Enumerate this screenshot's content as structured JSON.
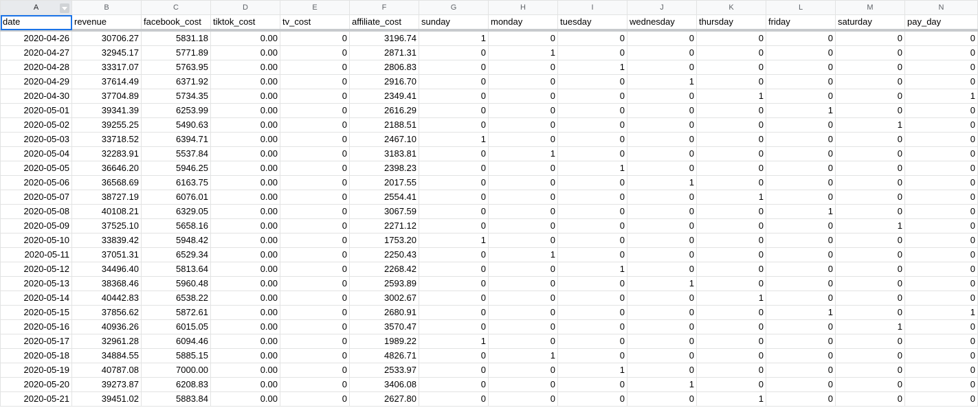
{
  "columns": [
    "A",
    "B",
    "C",
    "D",
    "E",
    "F",
    "G",
    "H",
    "I",
    "J",
    "K",
    "L",
    "M",
    "N"
  ],
  "headers": [
    "date",
    "revenue",
    "facebook_cost",
    "tiktok_cost",
    "tv_cost",
    "affiliate_cost",
    "sunday",
    "monday",
    "tuesday",
    "wednesday",
    "thursday",
    "friday",
    "saturday",
    "pay_day"
  ],
  "rows": [
    [
      "2020-04-26",
      "30706.27",
      "5831.18",
      "0.00",
      "0",
      "3196.74",
      "1",
      "0",
      "0",
      "0",
      "0",
      "0",
      "0",
      "0"
    ],
    [
      "2020-04-27",
      "32945.17",
      "5771.89",
      "0.00",
      "0",
      "2871.31",
      "0",
      "1",
      "0",
      "0",
      "0",
      "0",
      "0",
      "0"
    ],
    [
      "2020-04-28",
      "33317.07",
      "5763.95",
      "0.00",
      "0",
      "2806.83",
      "0",
      "0",
      "1",
      "0",
      "0",
      "0",
      "0",
      "0"
    ],
    [
      "2020-04-29",
      "37614.49",
      "6371.92",
      "0.00",
      "0",
      "2916.70",
      "0",
      "0",
      "0",
      "1",
      "0",
      "0",
      "0",
      "0"
    ],
    [
      "2020-04-30",
      "37704.89",
      "5734.35",
      "0.00",
      "0",
      "2349.41",
      "0",
      "0",
      "0",
      "0",
      "1",
      "0",
      "0",
      "1"
    ],
    [
      "2020-05-01",
      "39341.39",
      "6253.99",
      "0.00",
      "0",
      "2616.29",
      "0",
      "0",
      "0",
      "0",
      "0",
      "1",
      "0",
      "0"
    ],
    [
      "2020-05-02",
      "39255.25",
      "5490.63",
      "0.00",
      "0",
      "2188.51",
      "0",
      "0",
      "0",
      "0",
      "0",
      "0",
      "1",
      "0"
    ],
    [
      "2020-05-03",
      "33718.52",
      "6394.71",
      "0.00",
      "0",
      "2467.10",
      "1",
      "0",
      "0",
      "0",
      "0",
      "0",
      "0",
      "0"
    ],
    [
      "2020-05-04",
      "32283.91",
      "5537.84",
      "0.00",
      "0",
      "3183.81",
      "0",
      "1",
      "0",
      "0",
      "0",
      "0",
      "0",
      "0"
    ],
    [
      "2020-05-05",
      "36646.20",
      "5946.25",
      "0.00",
      "0",
      "2398.23",
      "0",
      "0",
      "1",
      "0",
      "0",
      "0",
      "0",
      "0"
    ],
    [
      "2020-05-06",
      "36568.69",
      "6163.75",
      "0.00",
      "0",
      "2017.55",
      "0",
      "0",
      "0",
      "1",
      "0",
      "0",
      "0",
      "0"
    ],
    [
      "2020-05-07",
      "38727.19",
      "6076.01",
      "0.00",
      "0",
      "2554.41",
      "0",
      "0",
      "0",
      "0",
      "1",
      "0",
      "0",
      "0"
    ],
    [
      "2020-05-08",
      "40108.21",
      "6329.05",
      "0.00",
      "0",
      "3067.59",
      "0",
      "0",
      "0",
      "0",
      "0",
      "1",
      "0",
      "0"
    ],
    [
      "2020-05-09",
      "37525.10",
      "5658.16",
      "0.00",
      "0",
      "2271.12",
      "0",
      "0",
      "0",
      "0",
      "0",
      "0",
      "1",
      "0"
    ],
    [
      "2020-05-10",
      "33839.42",
      "5948.42",
      "0.00",
      "0",
      "1753.20",
      "1",
      "0",
      "0",
      "0",
      "0",
      "0",
      "0",
      "0"
    ],
    [
      "2020-05-11",
      "37051.31",
      "6529.34",
      "0.00",
      "0",
      "2250.43",
      "0",
      "1",
      "0",
      "0",
      "0",
      "0",
      "0",
      "0"
    ],
    [
      "2020-05-12",
      "34496.40",
      "5813.64",
      "0.00",
      "0",
      "2268.42",
      "0",
      "0",
      "1",
      "0",
      "0",
      "0",
      "0",
      "0"
    ],
    [
      "2020-05-13",
      "38368.46",
      "5960.48",
      "0.00",
      "0",
      "2593.89",
      "0",
      "0",
      "0",
      "1",
      "0",
      "0",
      "0",
      "0"
    ],
    [
      "2020-05-14",
      "40442.83",
      "6538.22",
      "0.00",
      "0",
      "3002.67",
      "0",
      "0",
      "0",
      "0",
      "1",
      "0",
      "0",
      "0"
    ],
    [
      "2020-05-15",
      "37856.62",
      "5872.61",
      "0.00",
      "0",
      "2680.91",
      "0",
      "0",
      "0",
      "0",
      "0",
      "1",
      "0",
      "1"
    ],
    [
      "2020-05-16",
      "40936.26",
      "6015.05",
      "0.00",
      "0",
      "3570.47",
      "0",
      "0",
      "0",
      "0",
      "0",
      "0",
      "1",
      "0"
    ],
    [
      "2020-05-17",
      "32961.28",
      "6094.46",
      "0.00",
      "0",
      "1989.22",
      "1",
      "0",
      "0",
      "0",
      "0",
      "0",
      "0",
      "0"
    ],
    [
      "2020-05-18",
      "34884.55",
      "5885.15",
      "0.00",
      "0",
      "4826.71",
      "0",
      "1",
      "0",
      "0",
      "0",
      "0",
      "0",
      "0"
    ],
    [
      "2020-05-19",
      "40787.08",
      "7000.00",
      "0.00",
      "0",
      "2533.97",
      "0",
      "0",
      "1",
      "0",
      "0",
      "0",
      "0",
      "0"
    ],
    [
      "2020-05-20",
      "39273.87",
      "6208.83",
      "0.00",
      "0",
      "3406.08",
      "0",
      "0",
      "0",
      "1",
      "0",
      "0",
      "0",
      "0"
    ],
    [
      "2020-05-21",
      "39451.02",
      "5883.84",
      "0.00",
      "0",
      "2627.80",
      "0",
      "0",
      "0",
      "0",
      "1",
      "0",
      "0",
      "0"
    ]
  ]
}
